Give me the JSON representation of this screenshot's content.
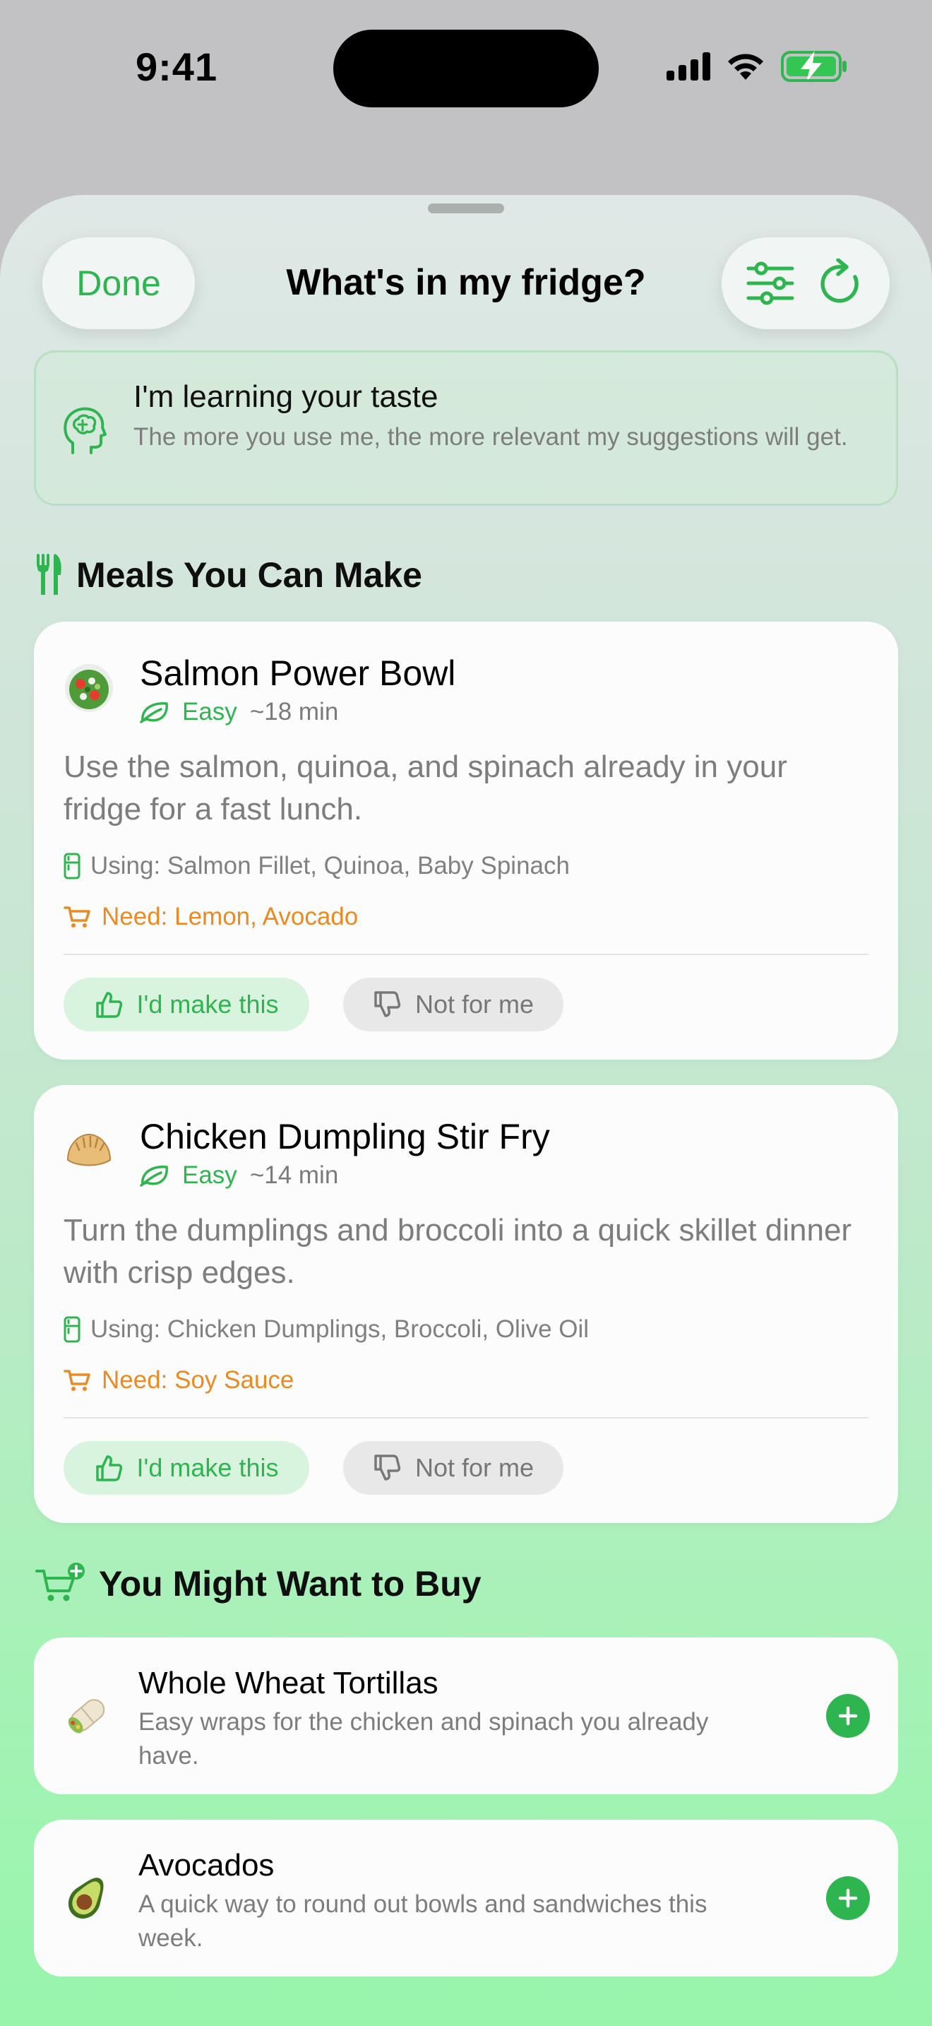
{
  "status_bar": {
    "time": "9:41"
  },
  "header": {
    "done_label": "Done",
    "title": "What's in my fridge?"
  },
  "learning_banner": {
    "title": "I'm learning your taste",
    "subtitle": "The more you use me, the more relevant my suggestions will get."
  },
  "meals_section": {
    "title": "Meals You Can Make",
    "meals": [
      {
        "name": "Salmon Power Bowl",
        "difficulty": "Easy",
        "time": "~18 min",
        "description": "Use the salmon, quinoa, and spinach already in your fridge for a fast lunch.",
        "using": "Using: Salmon Fillet, Quinoa, Baby Spinach",
        "need": "Need: Lemon, Avocado",
        "like_label": "I'd make this",
        "dislike_label": "Not for me",
        "icon": "salad-bowl-icon"
      },
      {
        "name": "Chicken Dumpling Stir Fry",
        "difficulty": "Easy",
        "time": "~14 min",
        "description": "Turn the dumplings and broccoli into a quick skillet dinner with crisp edges.",
        "using": "Using: Chicken Dumplings, Broccoli, Olive Oil",
        "need": "Need: Soy Sauce",
        "like_label": "I'd make this",
        "dislike_label": "Not for me",
        "icon": "dumpling-icon"
      }
    ]
  },
  "buy_section": {
    "title": "You Might Want to Buy",
    "items": [
      {
        "name": "Whole Wheat Tortillas",
        "description": "Easy wraps for the chicken and spinach you already have.",
        "icon": "burrito-icon"
      },
      {
        "name": "Avocados",
        "description": "A quick way to round out bowls and sandwiches this week.",
        "icon": "avocado-icon"
      }
    ]
  },
  "colors": {
    "accent_green": "#2fb550",
    "need_orange": "#e98a23",
    "secondary_text": "#7d7d7d"
  }
}
